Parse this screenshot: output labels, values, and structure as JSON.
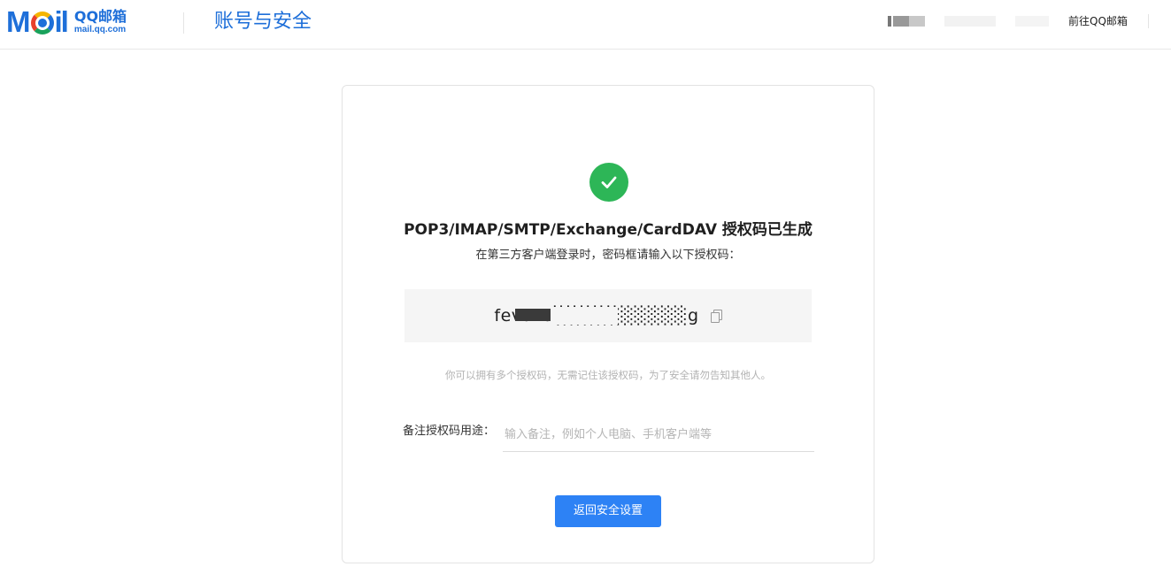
{
  "header": {
    "logo_text": "Mail",
    "logo_cn": "QQ邮箱",
    "logo_domain": "mail.qq.com",
    "page_title": "账号与安全",
    "goto_label": "前往QQ邮箱"
  },
  "card": {
    "title": "POP3/IMAP/SMTP/Exchange/CardDAV 授权码已生成",
    "subtitle": "在第三方客户端登录时，密码框请输入以下授权码：",
    "auth_code": "fevuxa░░░░░░░░░░g",
    "hint": "你可以拥有多个授权码，无需记住该授权码，为了安全请勿告知其他人。",
    "note_label": "备注授权码用途：",
    "note_placeholder": "输入备注，例如个人电脑、手机客户端等",
    "note_value": "",
    "back_button": "返回安全设置"
  },
  "icons": {
    "success": "check-circle-icon",
    "copy": "copy-icon"
  },
  "colors": {
    "brand_blue": "#1e6fd9",
    "success_green": "#2db657",
    "button_blue": "#2d82f5"
  }
}
